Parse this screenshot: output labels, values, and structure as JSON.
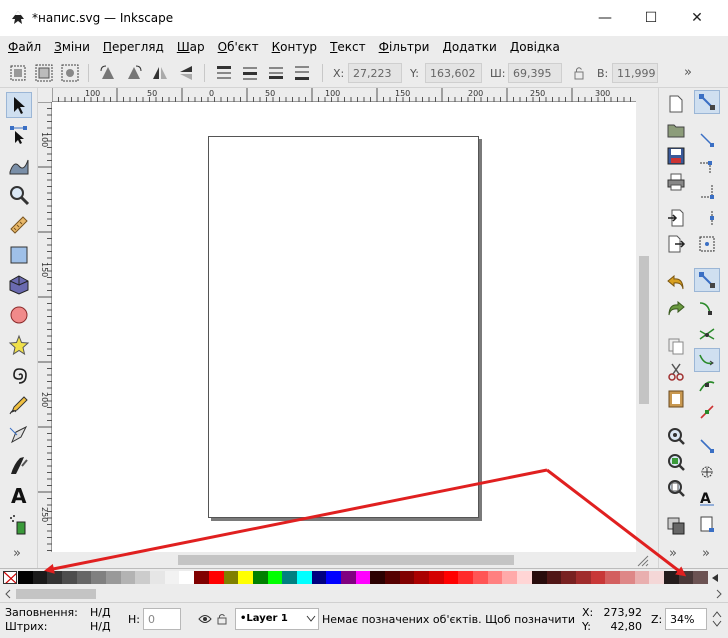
{
  "window": {
    "title": "*напис.svg — Inkscape",
    "minimize_glyph": "—",
    "maximize_glyph": "☐",
    "close_glyph": "✕"
  },
  "menu": [
    {
      "label": "Файл",
      "underline": "Ф",
      "rest": "айл"
    },
    {
      "label": "Зміни",
      "underline": "З",
      "rest": "міни"
    },
    {
      "label": "Перегляд",
      "underline": "П",
      "rest": "ерегляд"
    },
    {
      "label": "Шар",
      "underline": "Ш",
      "rest": "ар"
    },
    {
      "label": "Об'єкт",
      "underline": "О",
      "rest": "б'єкт"
    },
    {
      "label": "Контур",
      "underline": "К",
      "rest": "онтур"
    },
    {
      "label": "Текст",
      "underline": "Т",
      "rest": "екст"
    },
    {
      "label": "Фільтри",
      "underline": "Ф",
      "rest": "ільтри"
    },
    {
      "label": "Додатки",
      "underline": "Д",
      "rest": "одатки"
    },
    {
      "label": "Довідка",
      "underline": "Д",
      "rest": "овідка"
    }
  ],
  "toolcontrols": {
    "x_label": "X:",
    "x_value": "27,223",
    "y_label": "Y:",
    "y_value": "163,602",
    "w_label": "Ш:",
    "w_value": "69,395",
    "h_label": "В:",
    "h_value": "11,999",
    "lock_icon": "lock-icon",
    "more": "»"
  },
  "ruler": {
    "top_labels": [
      "100",
      "50",
      "0",
      "50",
      "100",
      "150",
      "200",
      "250",
      "300"
    ],
    "left_labels": [
      "100",
      "150",
      "200",
      "250"
    ]
  },
  "toolbox_more": "»",
  "commands_more": "»",
  "snap_more": "»",
  "palette": {
    "none_label": "X",
    "colors": [
      "#000000",
      "#1a1a1a",
      "#333333",
      "#4d4d4d",
      "#666666",
      "#808080",
      "#999999",
      "#b3b3b3",
      "#cccccc",
      "#e6e6e6",
      "#f2f2f2",
      "#ffffff",
      "#800000",
      "#ff0000",
      "#808000",
      "#ffff00",
      "#008000",
      "#00ff00",
      "#008080",
      "#00ffff",
      "#000080",
      "#0000ff",
      "#800080",
      "#ff00ff",
      "#2b0000",
      "#550000",
      "#800000",
      "#aa0000",
      "#d40000",
      "#ff0000",
      "#ff2a2a",
      "#ff5555",
      "#ff8080",
      "#ffaaaa",
      "#ffd5d5",
      "#280b0b",
      "#501616",
      "#782121",
      "#a02c2c",
      "#c83737",
      "#d35f5f",
      "#de8787",
      "#e9afaf",
      "#f4d7d7",
      "#241c1c",
      "#483737",
      "#6c5353"
    ]
  },
  "status": {
    "fill_label": "Заповнення:",
    "fill_value": "Н/Д",
    "stroke_label": "Штрих:",
    "stroke_value": "Н/Д",
    "h_label": "H:",
    "h_value": "0",
    "layer": "•Layer 1",
    "message": "Немає позначених об'єктів. Щоб позначити ...",
    "x_label": "X:",
    "x_value": "273,92",
    "y_label": "Y:",
    "y_value": "42,80",
    "zoom_label": "Z:",
    "zoom_value": "34%"
  },
  "colors": {
    "annotation_arrow": "#e02020",
    "active_tool_bg": "#cfdff0"
  }
}
